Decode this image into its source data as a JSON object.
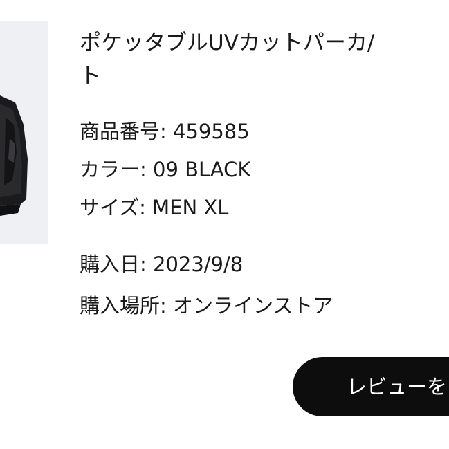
{
  "product": {
    "title_line1": "ポケッタブルUVカットパーカ/",
    "title_line2": "ト",
    "image_icon": "black-hooded-jacket-image"
  },
  "details": {
    "code": "商品番号: 459585",
    "color": "カラー: 09 BLACK",
    "size": "サイズ: MEN XL",
    "purchase_date": "購入日: 2023/9/8",
    "purchase_place": "購入場所: オンラインストア"
  },
  "actions": {
    "review_label": "レビューを"
  },
  "colors": {
    "button_bg": "#0d0d0d",
    "button_text": "#ffffff",
    "image_bg": "#eef0f3"
  }
}
